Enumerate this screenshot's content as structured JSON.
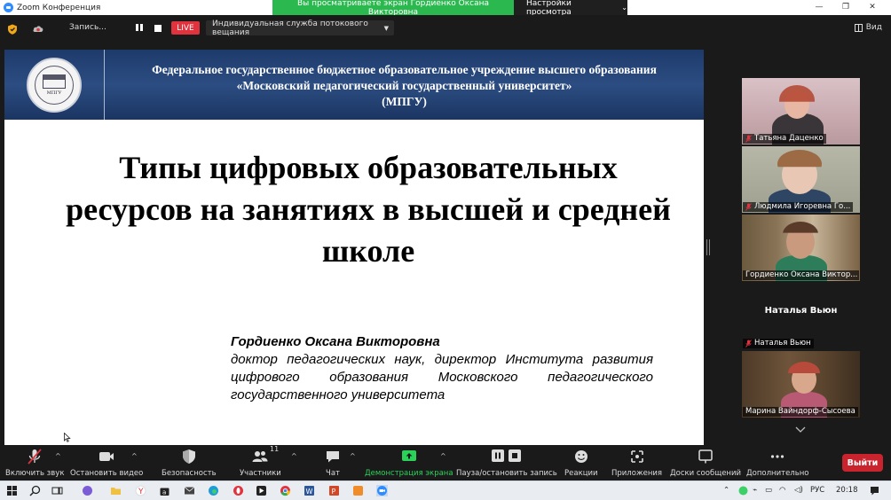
{
  "window": {
    "title": "Zoom Конференция",
    "controls": {
      "minimize": "—",
      "maximize": "❐",
      "close": "✕"
    }
  },
  "share_banner": {
    "message": "Вы просматриваете экран Гордиенко Оксана Викторовна",
    "view_options": "Настройки просмотра"
  },
  "top_bar": {
    "recording_label": "Запись...",
    "live_label": "LIVE",
    "stream_service": "Индивидуальная служба потокового вещания",
    "view_label": "Вид"
  },
  "slide": {
    "org_line1": "Федеральное государственное бюджетное образовательное учреждение высшего образования",
    "org_line2": "«Московский педагогический государственный университет»",
    "org_line3": "(МПГУ)",
    "logo_text": "МПГУ",
    "title": "Типы цифровых образовательных ресурсов на занятиях в высшей и средней школе",
    "author_name": "Гордиенко Оксана Викторовна",
    "author_desc": "доктор педагогических наук, директор Института развития цифрового образования Московского педагогического государственного университета"
  },
  "participants": [
    {
      "name": "Татьяна Даценко",
      "muted": true,
      "video": true,
      "active": false
    },
    {
      "name": "Людмила Игоревна Го...",
      "muted": true,
      "video": true,
      "active": false
    },
    {
      "name": "Гордиенко Оксана Виктор...",
      "muted": false,
      "video": true,
      "active": true
    },
    {
      "name": "Наталья Вьюн",
      "muted": true,
      "video": false,
      "active": false,
      "display_name": "Наталья Вьюн"
    },
    {
      "name": "Марина Вайндорф-Сысоева",
      "muted": false,
      "video": true,
      "active": false
    }
  ],
  "toolbar": {
    "unmute": "Включить звук",
    "stop_video": "Остановить видео",
    "security": "Безопасность",
    "participants": "Участники",
    "participants_count": "11",
    "chat": "Чат",
    "share_screen": "Демонстрация экрана",
    "pause_recording": "Пауза/остановить запись",
    "reactions": "Реакции",
    "apps": "Приложения",
    "whiteboards": "Доски сообщений",
    "more": "Дополнительно",
    "leave": "Выйти"
  },
  "taskbar": {
    "language": "РУС",
    "time": "20:18"
  },
  "colors": {
    "share_green": "#2bb84f",
    "live_red": "#e0333e",
    "leave_red": "#c9242e",
    "active_speaker": "#d8d83a",
    "slide_header": "#1e3a6b"
  }
}
